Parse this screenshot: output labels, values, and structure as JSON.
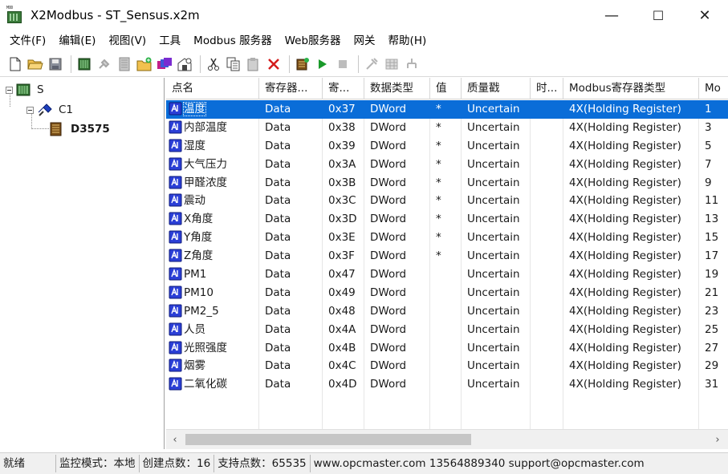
{
  "window": {
    "title": "X2Modbus - ST_Sensus.x2m",
    "icon_caption": "MOD",
    "minimize_glyph": "—",
    "maximize_glyph": "☐",
    "close_glyph": "✕"
  },
  "menu": [
    "文件(F)",
    "编辑(E)",
    "视图(V)",
    "工具",
    "Modbus 服务器",
    "Web服务器",
    "网关",
    "帮助(H)"
  ],
  "toolbar": {
    "icons": [
      "new-file-icon",
      "open-folder-icon",
      "save-icon",
      "add-device-icon",
      "connect-icon",
      "device-grid-icon",
      "new-group-icon",
      "batch-tags-icon",
      "properties-icon",
      "cut-icon",
      "copy-icon",
      "paste-icon",
      "delete-icon",
      "monitor-icon",
      "run-icon",
      "stop-icon",
      "tools-icon",
      "table-icon",
      "tree-icon"
    ]
  },
  "tree": {
    "root": "S",
    "channel": "C1",
    "device": "D3575"
  },
  "table": {
    "columns": [
      "点名",
      "寄存器...",
      "寄...",
      "数据类型",
      "值",
      "质量戳",
      "时...",
      "Modbus寄存器类型",
      "Mo"
    ],
    "selected_index": 0,
    "rows": [
      {
        "name": "温度",
        "reg": "Data",
        "addr": "0x37",
        "type": "DWord",
        "value": "*",
        "quality": "Uncertain",
        "time": "",
        "mtype": "4X(Holding Register)",
        "mo": "1"
      },
      {
        "name": "内部温度",
        "reg": "Data",
        "addr": "0x38",
        "type": "DWord",
        "value": "*",
        "quality": "Uncertain",
        "time": "",
        "mtype": "4X(Holding Register)",
        "mo": "3"
      },
      {
        "name": "湿度",
        "reg": "Data",
        "addr": "0x39",
        "type": "DWord",
        "value": "*",
        "quality": "Uncertain",
        "time": "",
        "mtype": "4X(Holding Register)",
        "mo": "5"
      },
      {
        "name": "大气压力",
        "reg": "Data",
        "addr": "0x3A",
        "type": "DWord",
        "value": "*",
        "quality": "Uncertain",
        "time": "",
        "mtype": "4X(Holding Register)",
        "mo": "7"
      },
      {
        "name": "甲醛浓度",
        "reg": "Data",
        "addr": "0x3B",
        "type": "DWord",
        "value": "*",
        "quality": "Uncertain",
        "time": "",
        "mtype": "4X(Holding Register)",
        "mo": "9"
      },
      {
        "name": "震动",
        "reg": "Data",
        "addr": "0x3C",
        "type": "DWord",
        "value": "*",
        "quality": "Uncertain",
        "time": "",
        "mtype": "4X(Holding Register)",
        "mo": "11"
      },
      {
        "name": "X角度",
        "reg": "Data",
        "addr": "0x3D",
        "type": "DWord",
        "value": "*",
        "quality": "Uncertain",
        "time": "",
        "mtype": "4X(Holding Register)",
        "mo": "13"
      },
      {
        "name": "Y角度",
        "reg": "Data",
        "addr": "0x3E",
        "type": "DWord",
        "value": "*",
        "quality": "Uncertain",
        "time": "",
        "mtype": "4X(Holding Register)",
        "mo": "15"
      },
      {
        "name": "Z角度",
        "reg": "Data",
        "addr": "0x3F",
        "type": "DWord",
        "value": "*",
        "quality": "Uncertain",
        "time": "",
        "mtype": "4X(Holding Register)",
        "mo": "17"
      },
      {
        "name": "PM1",
        "reg": "Data",
        "addr": "0x47",
        "type": "DWord",
        "value": "",
        "quality": "Uncertain",
        "time": "",
        "mtype": "4X(Holding Register)",
        "mo": "19"
      },
      {
        "name": "PM10",
        "reg": "Data",
        "addr": "0x49",
        "type": "DWord",
        "value": "",
        "quality": "Uncertain",
        "time": "",
        "mtype": "4X(Holding Register)",
        "mo": "21"
      },
      {
        "name": "PM2_5",
        "reg": "Data",
        "addr": "0x48",
        "type": "DWord",
        "value": "",
        "quality": "Uncertain",
        "time": "",
        "mtype": "4X(Holding Register)",
        "mo": "23"
      },
      {
        "name": "人员",
        "reg": "Data",
        "addr": "0x4A",
        "type": "DWord",
        "value": "",
        "quality": "Uncertain",
        "time": "",
        "mtype": "4X(Holding Register)",
        "mo": "25"
      },
      {
        "name": "光照强度",
        "reg": "Data",
        "addr": "0x4B",
        "type": "DWord",
        "value": "",
        "quality": "Uncertain",
        "time": "",
        "mtype": "4X(Holding Register)",
        "mo": "27"
      },
      {
        "name": "烟雾",
        "reg": "Data",
        "addr": "0x4C",
        "type": "DWord",
        "value": "",
        "quality": "Uncertain",
        "time": "",
        "mtype": "4X(Holding Register)",
        "mo": "29"
      },
      {
        "name": "二氧化碳",
        "reg": "Data",
        "addr": "0x4D",
        "type": "DWord",
        "value": "",
        "quality": "Uncertain",
        "time": "",
        "mtype": "4X(Holding Register)",
        "mo": "31"
      }
    ]
  },
  "scrollbar": {
    "left_arrow": "‹",
    "right_arrow": "›"
  },
  "status": {
    "ready": "就绪",
    "mode": "监控模式：本地",
    "created": "创建点数：16",
    "supported": "支持点数：65535",
    "contact": "www.opcmaster.com 13564889340 support@opcmaster.com"
  },
  "colors": {
    "selection": "#0a6dd8",
    "tag_icon": "#2b3fd6",
    "run_green": "#1a9a2a",
    "delete_red": "#d41c1c"
  }
}
